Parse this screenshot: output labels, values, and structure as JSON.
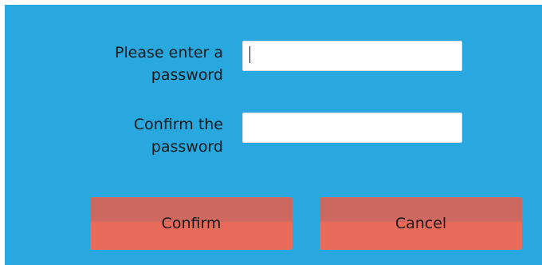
{
  "form": {
    "password_label": "Please enter a\npassword",
    "password_value": "",
    "confirm_label": "Confirm the\npassword",
    "confirm_value": ""
  },
  "actions": {
    "confirm_label": "Confirm",
    "cancel_label": "Cancel"
  },
  "colors": {
    "background": "#29a8e0",
    "field_background": "#ffffff",
    "button_top": "#cd6960",
    "button_bottom": "#e86a5b",
    "text": "#1a1a1a"
  }
}
